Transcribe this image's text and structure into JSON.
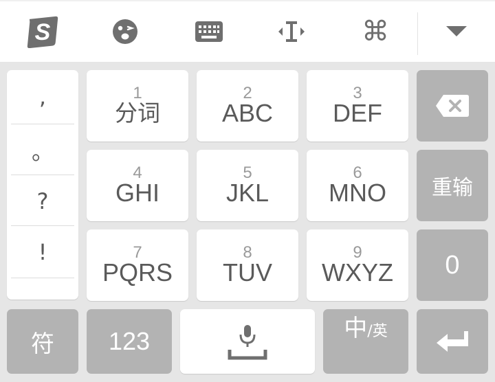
{
  "toolbar": {
    "items": [
      {
        "name": "sogou-logo-icon",
        "glyph": "S"
      },
      {
        "name": "emoji-icon"
      },
      {
        "name": "keyboard-icon"
      },
      {
        "name": "cursor-move-icon",
        "glyph": "I"
      },
      {
        "name": "command-icon",
        "glyph": "⌘"
      },
      {
        "name": "collapse-icon",
        "glyph": "▼"
      }
    ]
  },
  "punctuation": [
    ",",
    "。",
    "?",
    "!"
  ],
  "keys": [
    {
      "num": "1",
      "label": "分词"
    },
    {
      "num": "2",
      "label": "ABC"
    },
    {
      "num": "3",
      "label": "DEF"
    },
    {
      "num": "4",
      "label": "GHI"
    },
    {
      "num": "5",
      "label": "JKL"
    },
    {
      "num": "6",
      "label": "MNO"
    },
    {
      "num": "7",
      "label": "PQRS"
    },
    {
      "num": "8",
      "label": "TUV"
    },
    {
      "num": "9",
      "label": "WXYZ"
    }
  ],
  "side_keys": {
    "backspace_icon": "backspace-icon",
    "retype": "重输",
    "zero": "0"
  },
  "bottom_row": {
    "symbols": "符",
    "numbers": "123",
    "lang_main": "中",
    "lang_sep": "/",
    "lang_alt": "英",
    "space_icon": "microphone-icon",
    "enter_icon": "enter-icon"
  },
  "colors": {
    "key_white": "#ffffff",
    "key_grey": "#b3b3b3",
    "background": "#e6e6e6",
    "icon_grey": "#6f6f6f"
  }
}
